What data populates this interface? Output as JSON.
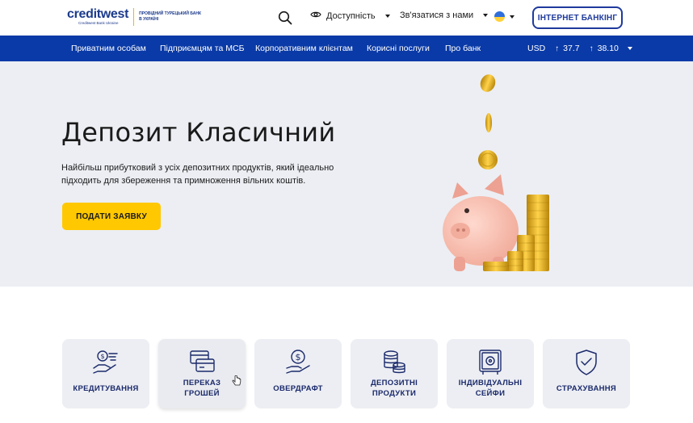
{
  "header": {
    "logo_word_main": "creditwest",
    "logo_subtitle": "Creditwest Bank Ukraine",
    "logo_tagline": "ПРОВІДНИЙ ТУРЕЦЬКИЙ БАНК В УКРАЇНІ",
    "accessibility_label": "Доступність",
    "contact_label": "Зв'язатися з нами",
    "internet_banking_label": "ІНТЕРНЕТ БАНКІНГ"
  },
  "nav": {
    "items": [
      "Приватним особам",
      "Підприємцям та МСБ",
      "Корпоративним клієнтам",
      "Корисні послуги",
      "Про банк"
    ],
    "currency": "USD",
    "rate_buy": "37.7",
    "rate_sell": "38.10"
  },
  "hero": {
    "title": "Депозит Класичний",
    "description": "Найбільш прибутковий з усіх депозитних продуктів, який ідеально підходить для збереження та примноження вільних коштів.",
    "apply_button": "ПОДАТИ ЗАЯВКУ"
  },
  "services": [
    {
      "label": "КРЕДИТУВАННЯ",
      "icon": "hand-coin-icon"
    },
    {
      "label": "ПЕРЕКАЗ\nГРОШЕЙ",
      "icon": "cards-transfer-icon"
    },
    {
      "label": "ОВЕРДРАФТ",
      "icon": "dollar-hand-icon"
    },
    {
      "label": "ДЕПОЗИТНІ\nПРОДУКТИ",
      "icon": "coin-stack-icon"
    },
    {
      "label": "ІНДИВІДУАЛЬНІ\nСЕЙФИ",
      "icon": "safe-icon"
    },
    {
      "label": "СТРАХУВАННЯ",
      "icon": "shield-check-icon"
    }
  ],
  "colors": {
    "brand_blue": "#0a3aa7",
    "accent_yellow": "#ffc800",
    "hero_bg": "#eceef3"
  }
}
